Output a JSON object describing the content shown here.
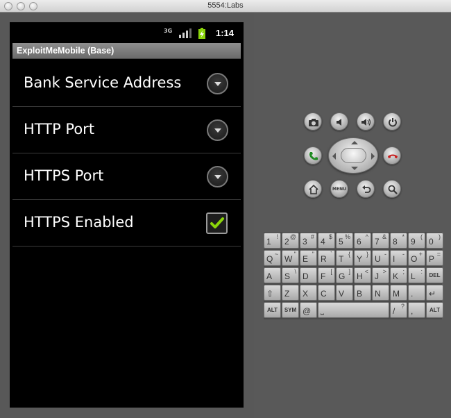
{
  "window": {
    "title": "5554:Labs"
  },
  "statusbar": {
    "network": "3G",
    "time": "1:14"
  },
  "app": {
    "title": "ExploitMeMobile (Base)",
    "preferences": [
      {
        "label": "Bank Service Address",
        "type": "list"
      },
      {
        "label": "HTTP Port",
        "type": "list"
      },
      {
        "label": "HTTPS Port",
        "type": "list"
      },
      {
        "label": "HTTPS Enabled",
        "type": "checkbox",
        "checked": true
      }
    ]
  },
  "controls": {
    "menu_label": "MENU",
    "icons": [
      "camera-icon",
      "volume-down-icon",
      "volume-up-icon",
      "power-icon",
      "call-icon",
      "end-call-icon",
      "home-icon",
      "menu-icon",
      "back-icon",
      "search-icon"
    ]
  },
  "keyboard": {
    "rows": [
      [
        {
          "m": "1",
          "s": "!"
        },
        {
          "m": "2",
          "s": "@"
        },
        {
          "m": "3",
          "s": "#"
        },
        {
          "m": "4",
          "s": "$"
        },
        {
          "m": "5",
          "s": "%"
        },
        {
          "m": "6",
          "s": "^"
        },
        {
          "m": "7",
          "s": "&"
        },
        {
          "m": "8",
          "s": "*"
        },
        {
          "m": "9",
          "s": "("
        },
        {
          "m": "0",
          "s": ")"
        }
      ],
      [
        {
          "m": "Q",
          "s": "~"
        },
        {
          "m": "W",
          "s": "\""
        },
        {
          "m": "E",
          "s": "\""
        },
        {
          "m": "R",
          "s": "`"
        },
        {
          "m": "T",
          "s": "{"
        },
        {
          "m": "Y",
          "s": "}"
        },
        {
          "m": "U",
          "s": "-"
        },
        {
          "m": "I",
          "s": "-"
        },
        {
          "m": "O",
          "s": "+"
        },
        {
          "m": "P",
          "s": "="
        }
      ],
      [
        {
          "m": "A",
          "s": ""
        },
        {
          "m": "S",
          "s": "\\"
        },
        {
          "m": "D",
          "s": ""
        },
        {
          "m": "F",
          "s": "["
        },
        {
          "m": "G",
          "s": "]"
        },
        {
          "m": "H",
          "s": "<"
        },
        {
          "m": "J",
          "s": ">"
        },
        {
          "m": "K",
          "s": ";"
        },
        {
          "m": "L",
          "s": ":"
        },
        {
          "m": "DEL",
          "s": ""
        }
      ],
      [
        {
          "m": "⇧",
          "s": ""
        },
        {
          "m": "Z",
          "s": ""
        },
        {
          "m": "X",
          "s": ""
        },
        {
          "m": "C",
          "s": ""
        },
        {
          "m": "V",
          "s": ""
        },
        {
          "m": "B",
          "s": ""
        },
        {
          "m": "N",
          "s": ""
        },
        {
          "m": "M",
          "s": ""
        },
        {
          "m": ".",
          "s": ""
        },
        {
          "m": "↵",
          "s": ""
        }
      ],
      [
        {
          "m": "ALT",
          "s": ""
        },
        {
          "m": "SYM",
          "s": ""
        },
        {
          "m": "@",
          "s": ""
        },
        {
          "m": "⎵",
          "s": ""
        },
        {
          "m": "/",
          "s": "?"
        },
        {
          "m": ",",
          "s": ""
        },
        {
          "m": "ALT",
          "s": ""
        }
      ]
    ]
  }
}
